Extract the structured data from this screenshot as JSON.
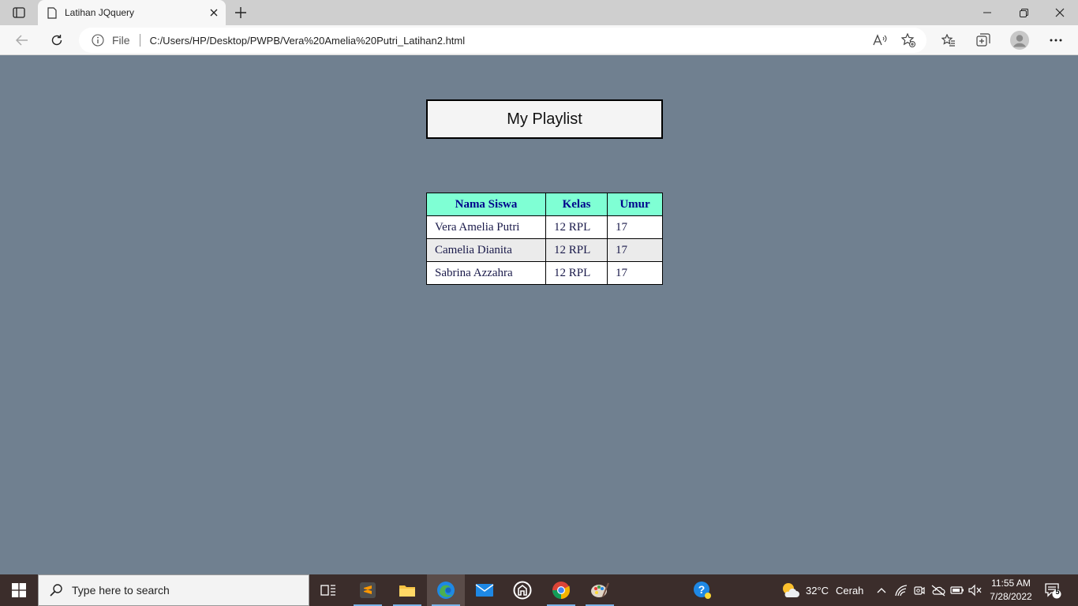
{
  "browser": {
    "tab_title": "Latihan JQquery",
    "address_label": "File",
    "url": "C:/Users/HP/Desktop/PWPB/Vera%20Amelia%20Putri_Latihan2.html"
  },
  "page": {
    "heading": "My Playlist",
    "table": {
      "headers": [
        "Nama Siswa",
        "Kelas",
        "Umur"
      ],
      "rows": [
        {
          "nama": "Vera Amelia Putri",
          "kelas": "12 RPL",
          "umur": "17"
        },
        {
          "nama": "Camelia Dianita",
          "kelas": "12 RPL",
          "umur": "17"
        },
        {
          "nama": "Sabrina Azzahra",
          "kelas": "12 RPL",
          "umur": "17"
        }
      ]
    },
    "colors": {
      "background": "#708090",
      "header_bg": "#7fffd4",
      "header_text": "#00008b",
      "row_alt_bg": "#ebebeb"
    }
  },
  "taskbar": {
    "search_placeholder": "Type here to search",
    "weather_temp": "32°C",
    "weather_desc": "Cerah",
    "time": "11:55 AM",
    "date": "7/28/2022",
    "notification_count": "5"
  }
}
